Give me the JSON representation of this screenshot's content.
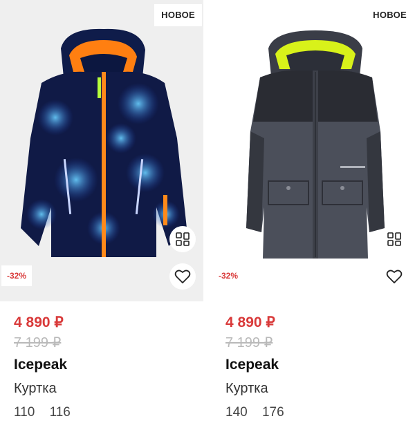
{
  "products": [
    {
      "badge_new": "НОВОЕ",
      "discount": "-32%",
      "price": "4 890 ₽",
      "old_price": "7 199 ₽",
      "brand": "Icepeak",
      "type": "Куртка",
      "sizes": [
        "110",
        "116"
      ],
      "image": "blue-patterned-winter-jacket-with-orange-hood-lining"
    },
    {
      "badge_new": "НОВОЕ",
      "discount": "-32%",
      "price": "4 890 ₽",
      "old_price": "7 199 ₽",
      "brand": "Icepeak",
      "type": "Куртка",
      "sizes": [
        "140",
        "176"
      ],
      "image": "dark-grey-jacket-with-yellow-hood-lining"
    }
  ],
  "icons": {
    "similar": "grid-similar-icon",
    "favorite": "heart-icon"
  },
  "colors": {
    "price_red": "#d93a3a",
    "old_price_grey": "#b9b9b9",
    "image_bg": "#efefef"
  }
}
